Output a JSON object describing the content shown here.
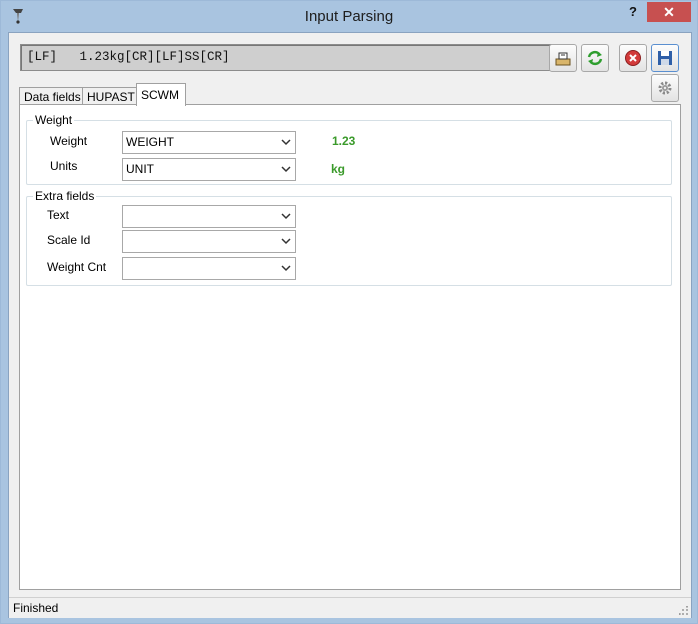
{
  "window": {
    "title": "Input Parsing",
    "help": "?",
    "close": "✕"
  },
  "input": {
    "raw": "[LF]   1.23kg[CR][LF]SS[CR]"
  },
  "toolbar": {
    "icons": [
      "scale-icon",
      "refresh-icon",
      "cancel-icon",
      "save-icon",
      "settings-icon"
    ]
  },
  "tabs": [
    {
      "label": "Data fields"
    },
    {
      "label": "HUPAST"
    },
    {
      "label": "SCWM"
    }
  ],
  "weight_group": {
    "title": "Weight",
    "weight_label": "Weight",
    "weight_value": "WEIGHT",
    "weight_result": "1.23",
    "units_label": "Units",
    "units_value": "UNIT",
    "units_result": "kg"
  },
  "extra_group": {
    "title": "Extra fields",
    "text_label": "Text",
    "text_value": "",
    "scale_label": "Scale Id",
    "scale_value": "",
    "count_label": "Weight Cnt",
    "count_value": ""
  },
  "status": {
    "text": "Finished"
  },
  "colors": {
    "titlebar": "#a9c4e0",
    "close": "#c75050",
    "green_value": "#3a9a2a"
  }
}
